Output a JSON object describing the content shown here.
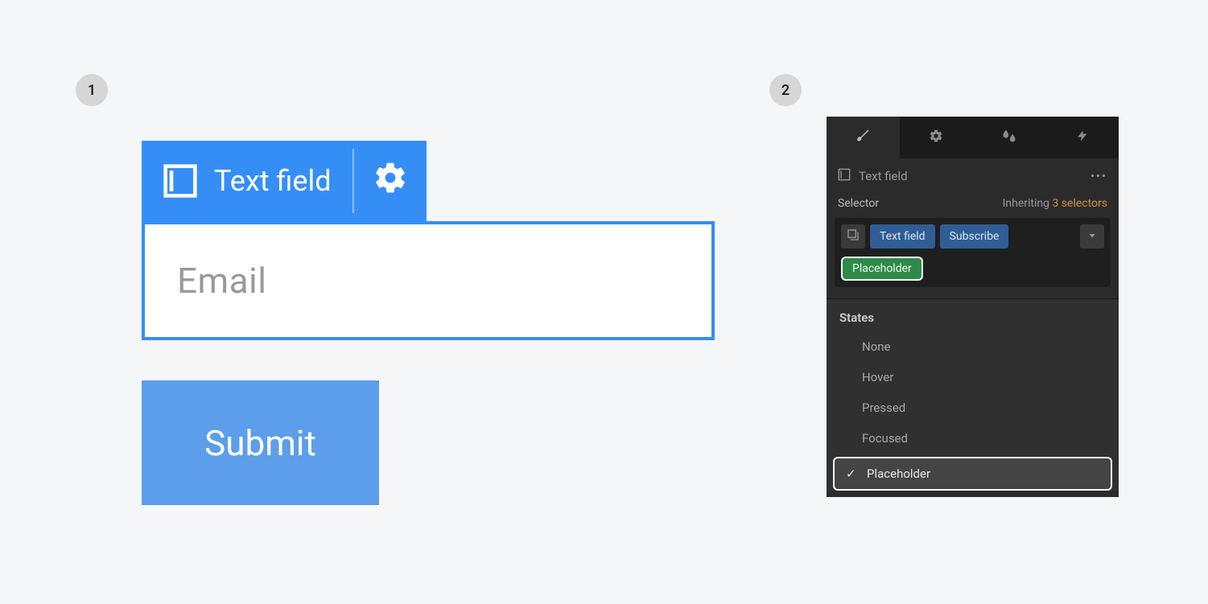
{
  "badges": {
    "one": "1",
    "two": "2"
  },
  "canvas": {
    "tag_label": "Text field",
    "placeholder": "Email",
    "submit_label": "Submit"
  },
  "panel": {
    "element_label": "Text field",
    "selector_label": "Selector",
    "inheriting_label": "Inheriting",
    "inheriting_count": "3 selectors",
    "chips": {
      "textfield": "Text field",
      "subscribe": "Subscribe",
      "placeholder": "Placeholder"
    },
    "states_header": "States",
    "states": {
      "none": "None",
      "hover": "Hover",
      "pressed": "Pressed",
      "focused": "Focused",
      "placeholder": "Placeholder"
    }
  }
}
